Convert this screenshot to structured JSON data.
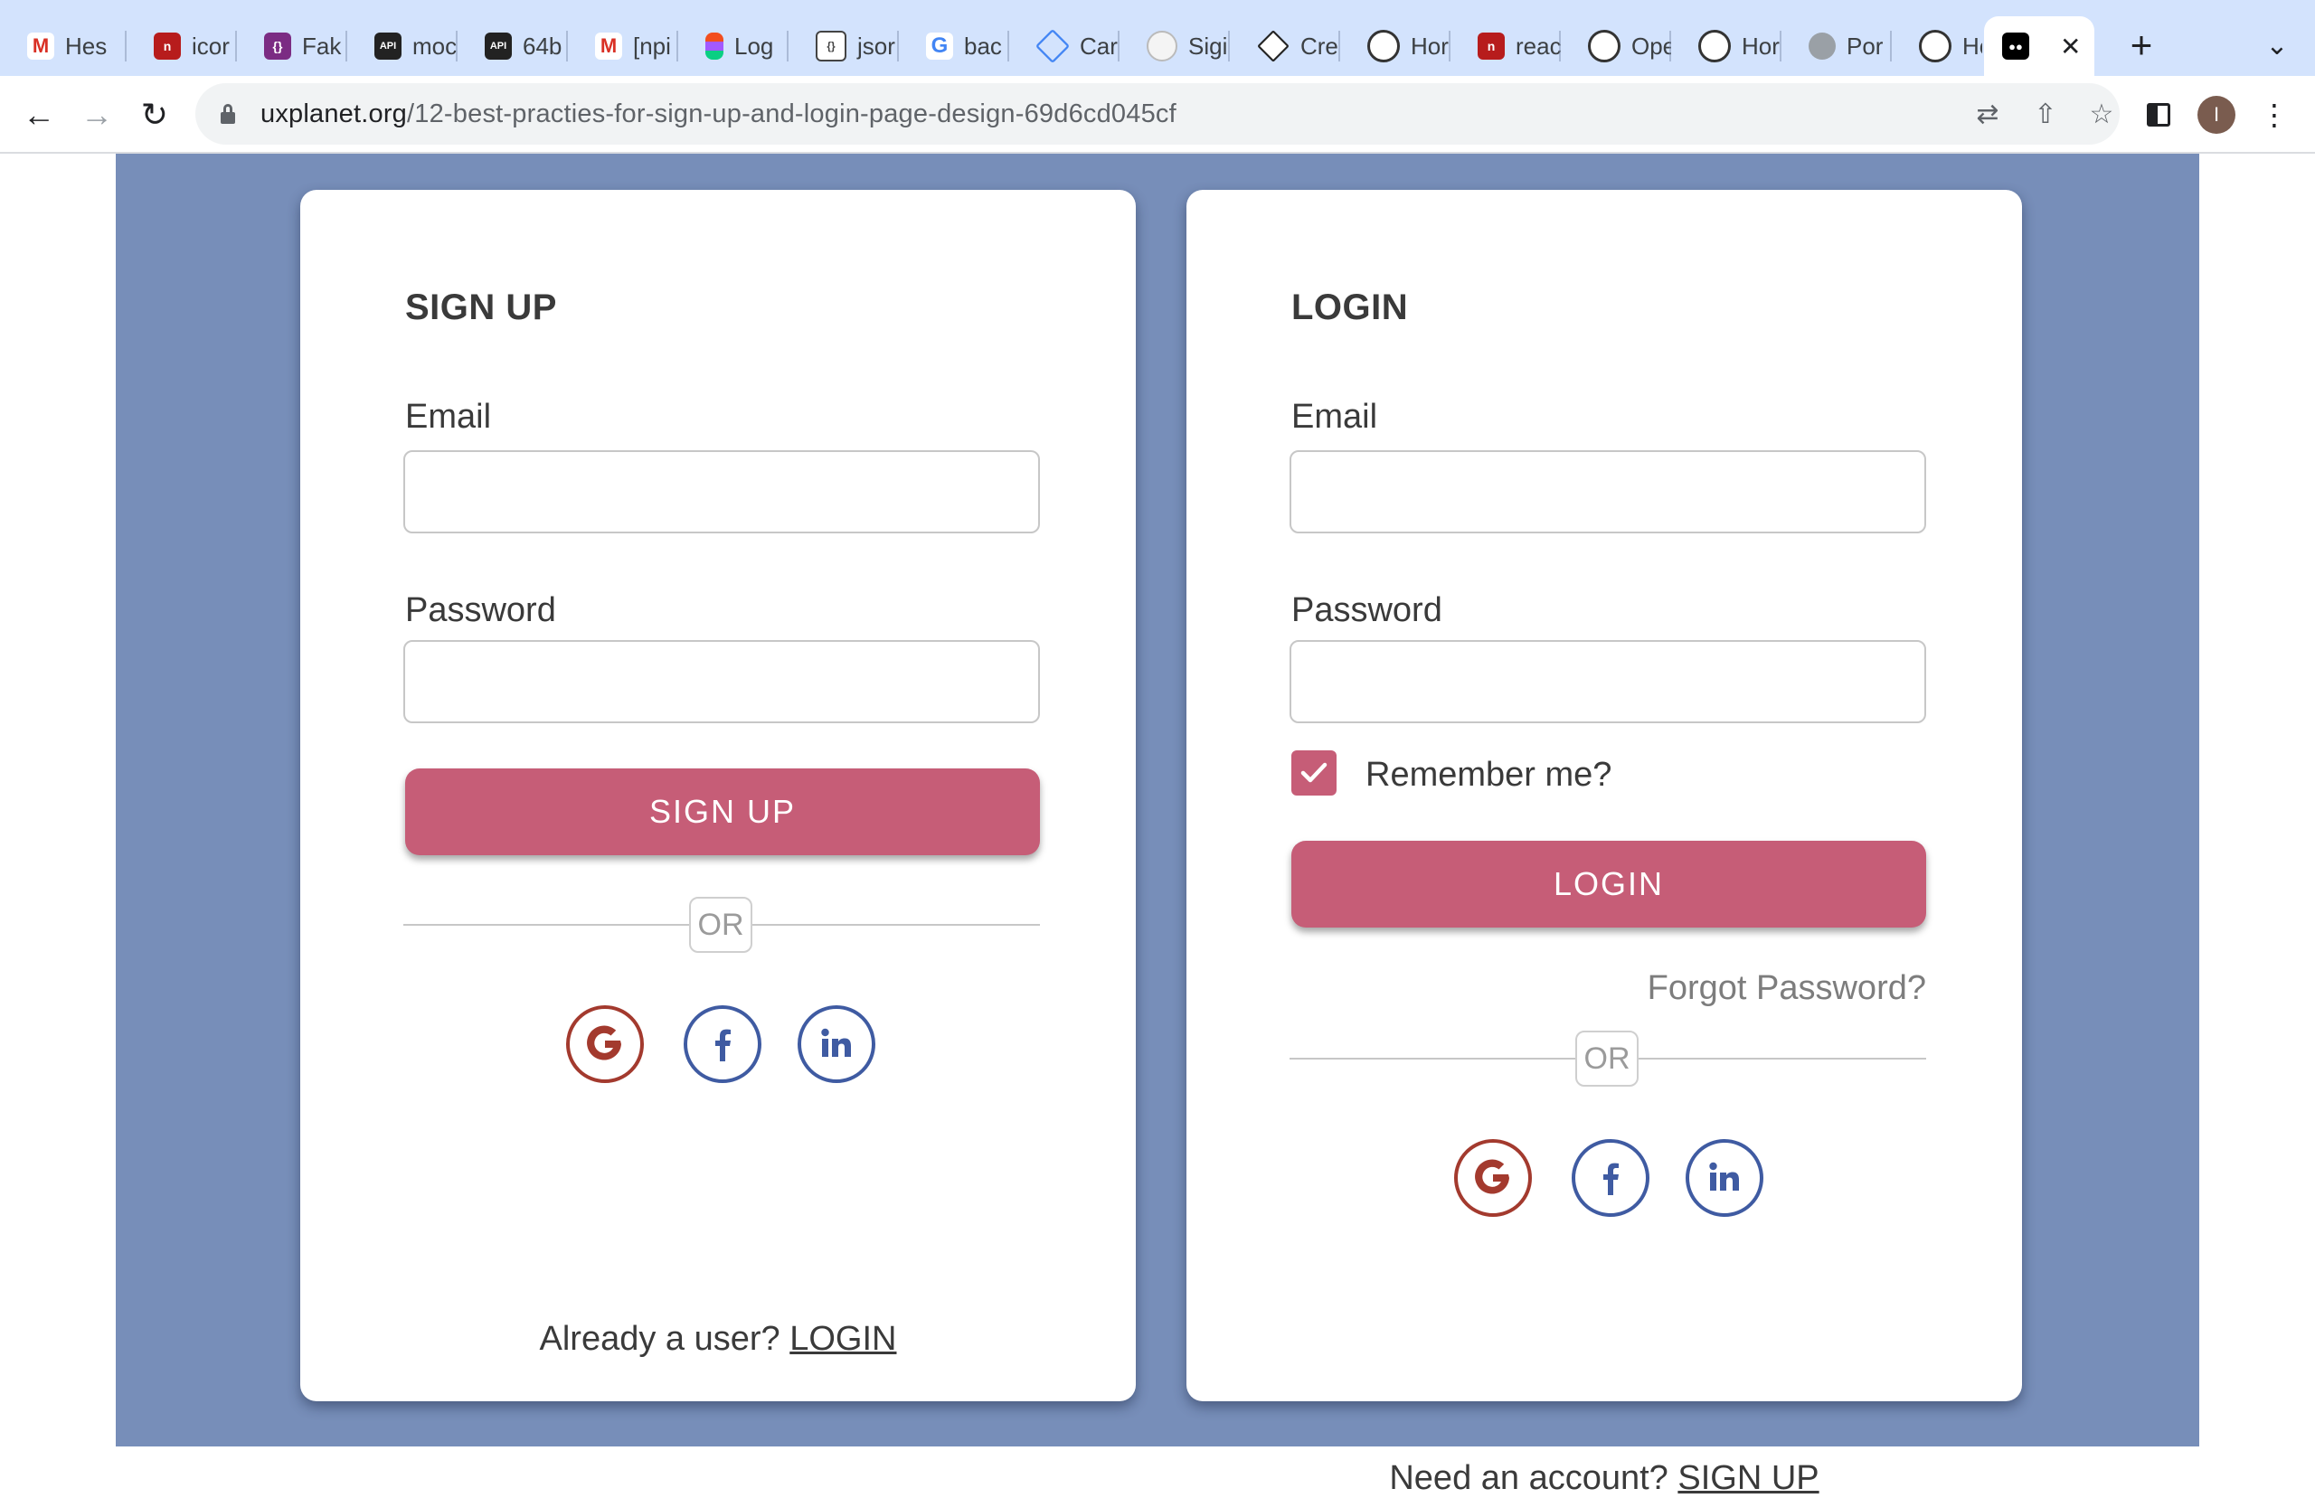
{
  "browser": {
    "tabs": [
      {
        "label": "Hes",
        "icon": "gmail-icon"
      },
      {
        "label": "icor",
        "icon": "red-n-icon"
      },
      {
        "label": "Fak",
        "icon": "fake-icon"
      },
      {
        "label": "moc",
        "icon": "mockapi-icon"
      },
      {
        "label": "64b",
        "icon": "mockapi-icon"
      },
      {
        "label": "[npi",
        "icon": "gmail-icon"
      },
      {
        "label": "Log",
        "icon": "figma-icon"
      },
      {
        "label": "jsor",
        "icon": "json-icon"
      },
      {
        "label": "bac",
        "icon": "google-icon"
      },
      {
        "label": "Car",
        "icon": "diamond-icon"
      },
      {
        "label": "Sigi",
        "icon": "github-icon"
      },
      {
        "label": "Cre",
        "icon": "codepen-icon"
      },
      {
        "label": "Hor",
        "icon": "chatgpt-icon"
      },
      {
        "label": "reac",
        "icon": "red-n-icon"
      },
      {
        "label": "Ope",
        "icon": "chatgpt-icon"
      },
      {
        "label": "Hor",
        "icon": "chatgpt-icon"
      },
      {
        "label": "Por",
        "icon": "globe-icon"
      },
      {
        "label": "Hor",
        "icon": "chatgpt-icon"
      }
    ],
    "active_tab": {
      "label": "",
      "icon": "medium-icon"
    },
    "url_host": "uxplanet.org",
    "url_path": "/12-best-practies-for-sign-up-and-login-page-design-69d6cd045cf",
    "profile_initial": "I"
  },
  "signup": {
    "title": "SIGN UP",
    "email_label": "Email",
    "email_value": "",
    "password_label": "Password",
    "password_value": "",
    "button_label": "SIGN UP",
    "or_label": "OR",
    "footer_text": "Already a user?",
    "footer_link": "LOGIN"
  },
  "login": {
    "title": "LOGIN",
    "email_label": "Email",
    "email_value": "",
    "password_label": "Password",
    "password_value": "",
    "remember_label": "Remember me?",
    "remember_checked": true,
    "button_label": "LOGIN",
    "forgot_label": "Forgot Password?",
    "or_label": "OR",
    "footer_text": "Need an account?",
    "footer_link": "SIGN UP"
  },
  "colors": {
    "page_background": "#778eb9",
    "primary": "#c65d77",
    "google": "#a33a2e",
    "social_blue": "#3f5ba2"
  }
}
